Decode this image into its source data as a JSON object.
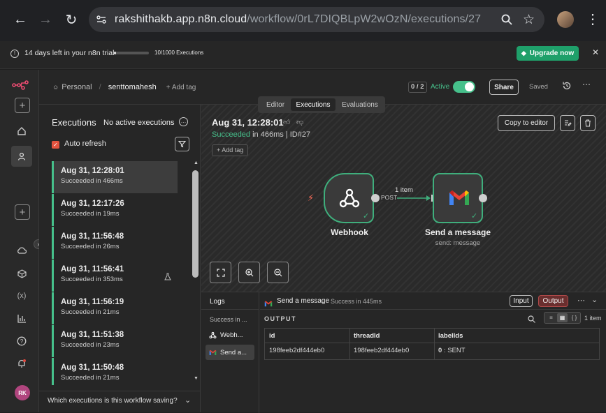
{
  "browser": {
    "url": "rakshithakb.app.n8n.cloud",
    "url_path": "/workflow/0rL7DIQBLpW2wOzN/executions/27"
  },
  "banner": {
    "trial_text": "14 days left in your n8n trial",
    "usage_text": "10/1000 Executions",
    "usage_fraction": 0.01,
    "upgrade_label": "Upgrade now"
  },
  "header": {
    "project": "Personal",
    "workflow_name": "senttomahesh",
    "add_tag": "+ Add tag",
    "counter": "0 / 2",
    "active_label": "Active",
    "share_label": "Share",
    "saved_label": "Saved",
    "tabs": [
      "Editor",
      "Executions",
      "Evaluations"
    ]
  },
  "sidebar": {
    "avatar_initials": "RK"
  },
  "executions": {
    "title": "Executions",
    "status": "No active executions",
    "auto_refresh": "Auto refresh",
    "footer": "Which executions is this workflow saving?",
    "items": [
      {
        "time": "Aug 31, 12:28:01",
        "status": "Succeeded in 466ms"
      },
      {
        "time": "Aug 31, 12:17:26",
        "status": "Succeeded in 19ms"
      },
      {
        "time": "Aug 31, 11:56:48",
        "status": "Succeeded in 26ms"
      },
      {
        "time": "Aug 31, 11:56:41",
        "status": "Succeeded in 353ms"
      },
      {
        "time": "Aug 31, 11:56:19",
        "status": "Succeeded in 21ms"
      },
      {
        "time": "Aug 31, 11:51:38",
        "status": "Succeeded in 23ms"
      },
      {
        "time": "Aug 31, 11:50:48",
        "status": "Succeeded in 21ms"
      }
    ]
  },
  "canvas": {
    "exec_time": "Aug 31, 12:28:01",
    "succeeded": "Succeeded",
    "duration": " in 466ms",
    "sep": " | ",
    "exec_id": "ID#27",
    "add_tag": "+ Add tag",
    "copy_label": "Copy to editor",
    "webhook_label": "Webhook",
    "method": "POST",
    "items_label": "1 item",
    "gmail_label": "Send a message",
    "gmail_sub": "send: message"
  },
  "logs": {
    "title": "Logs",
    "entries": [
      "Success in ...",
      "Webh...",
      "Send a..."
    ],
    "node_name": "Send a message",
    "node_status": "Success in 445ms",
    "input_label": "Input",
    "output_label": "Output",
    "output_heading": "OUTPUT",
    "item_count": "1 item",
    "columns": [
      "id",
      "threadId",
      "labelIds"
    ],
    "row": {
      "id": "198feeb2df444eb0",
      "threadId": "198feeb2df444eb0",
      "label_index": "0",
      "label_value": " : SENT"
    }
  },
  "colors": {
    "accent_green": "#46c08b",
    "upgrade_green": "#1fa06a",
    "output_red": "#b04a4a"
  }
}
